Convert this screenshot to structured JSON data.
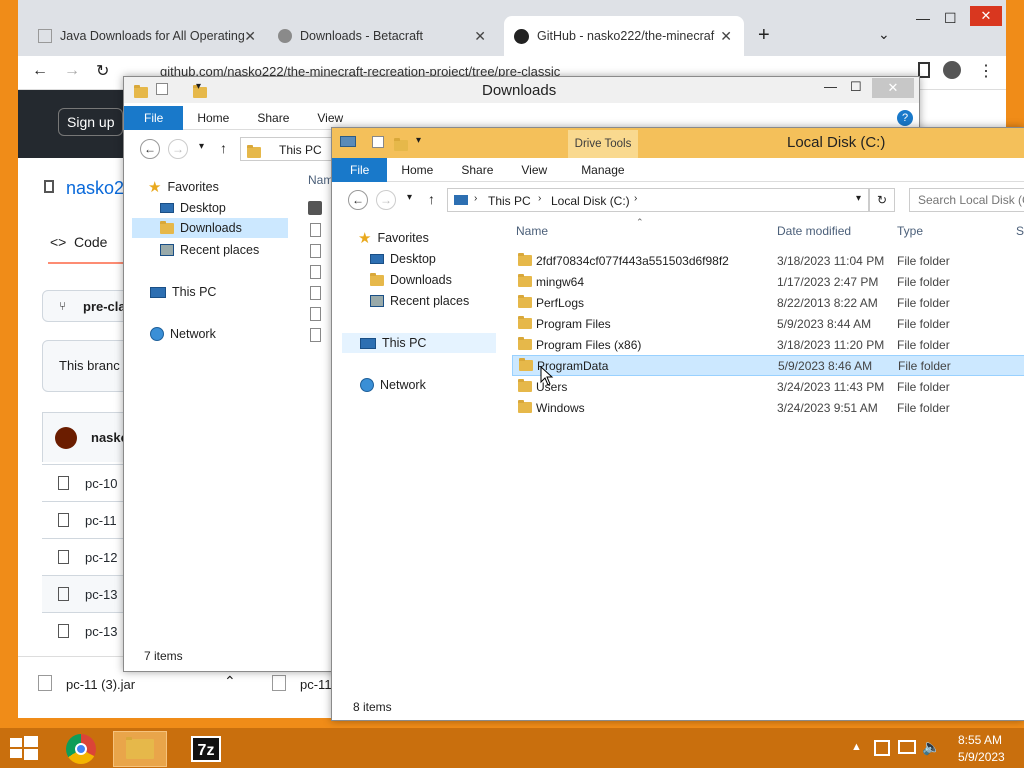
{
  "chrome": {
    "tabs": [
      {
        "title": "Java Downloads for All Operating"
      },
      {
        "title": "Downloads - Betacraft"
      },
      {
        "title": "GitHub - nasko222/the-minecraf"
      }
    ],
    "url": "github.com/nasko222/the-minecraft-recreation-project/tree/pre-classic",
    "signup": "Sign up",
    "repo": "nasko2",
    "code_tab": "Code",
    "branch": "pre-cla",
    "branch_msg": "This branc",
    "user": "nasko",
    "files": [
      "pc-10",
      "pc-11",
      "pc-12",
      "pc-13",
      "pc-13"
    ],
    "download_item": "pc-11 (3).jar",
    "download_item2": "pc-11"
  },
  "downloads_window": {
    "title": "Downloads",
    "ribbon": [
      "File",
      "Home",
      "Share",
      "View"
    ],
    "path": "This PC",
    "nav": {
      "favorites": "Favorites",
      "fav_items": [
        "Desktop",
        "Downloads",
        "Recent places"
      ],
      "this_pc": "This PC",
      "network": "Network"
    },
    "column": "Nam",
    "status": "7 items"
  },
  "disk_window": {
    "title": "Local Disk (C:)",
    "context_tab": "Drive Tools",
    "ribbon": [
      "File",
      "Home",
      "Share",
      "View",
      "Manage"
    ],
    "path": [
      "This PC",
      "Local Disk (C:)"
    ],
    "search_placeholder": "Search Local Disk (C",
    "nav": {
      "favorites": "Favorites",
      "fav_items": [
        "Desktop",
        "Downloads",
        "Recent places"
      ],
      "this_pc": "This PC",
      "network": "Network"
    },
    "columns": {
      "name": "Name",
      "date": "Date modified",
      "type": "Type",
      "size": "S"
    },
    "rows": [
      {
        "name": "2fdf70834cf077f443a551503d6f98f2",
        "date": "3/18/2023 11:04 PM",
        "type": "File folder"
      },
      {
        "name": "mingw64",
        "date": "1/17/2023 2:47 PM",
        "type": "File folder"
      },
      {
        "name": "PerfLogs",
        "date": "8/22/2013 8:22 AM",
        "type": "File folder"
      },
      {
        "name": "Program Files",
        "date": "5/9/2023 8:44 AM",
        "type": "File folder"
      },
      {
        "name": "Program Files (x86)",
        "date": "3/18/2023 11:20 PM",
        "type": "File folder"
      },
      {
        "name": "ProgramData",
        "date": "5/9/2023 8:46 AM",
        "type": "File folder"
      },
      {
        "name": "Users",
        "date": "3/24/2023 11:43 PM",
        "type": "File folder"
      },
      {
        "name": "Windows",
        "date": "3/24/2023 9:51 AM",
        "type": "File folder"
      }
    ],
    "selected_row": "ProgramData",
    "status": "8 items"
  },
  "taskbar": {
    "time": "8:55 AM",
    "date": "5/9/2023"
  }
}
